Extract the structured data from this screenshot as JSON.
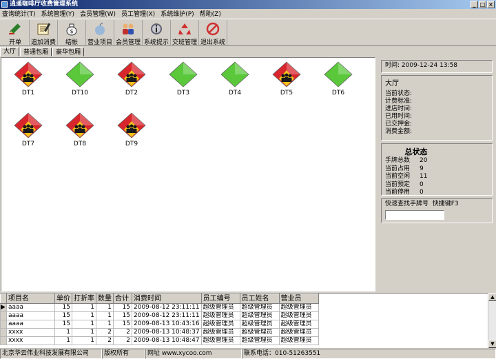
{
  "window": {
    "title": "逍遥咖啡厅收费管理系统"
  },
  "menu": [
    "查询统计(T)",
    "系统管理(Y)",
    "会员管理(W)",
    "员工管理(X)",
    "系统维护(P)",
    "帮助(Z)"
  ],
  "toolbar": [
    "开单",
    "追加消费",
    "结帐",
    "营业项目",
    "会员管理",
    "系统提示",
    "交班管理",
    "退出系统"
  ],
  "tabs": [
    "大厅",
    "普通包厢",
    "豪华包厢"
  ],
  "tables": [
    {
      "name": "DT1",
      "status": "occupied"
    },
    {
      "name": "DT10",
      "status": "free"
    },
    {
      "name": "DT2",
      "status": "occupied"
    },
    {
      "name": "DT3",
      "status": "free"
    },
    {
      "name": "DT4",
      "status": "free"
    },
    {
      "name": "DT5",
      "status": "occupied"
    },
    {
      "name": "DT6",
      "status": "free"
    },
    {
      "name": "DT7",
      "status": "occupied"
    },
    {
      "name": "DT8",
      "status": "occupied"
    },
    {
      "name": "DT9",
      "status": "occupied"
    }
  ],
  "colors": {
    "occupied": "#d8262c",
    "free": "#5ac83a",
    "person": "#1a1a1a",
    "person_bg": "#f2c21a"
  },
  "info": {
    "time_label": "时间:",
    "time_value": "2009-12-24 13:58",
    "area_title": "大厅",
    "fields": [
      "当前状态:",
      "计费标准:",
      "进店时间:",
      "已用时间:",
      "已交押金:",
      "消费金额:"
    ]
  },
  "summary": {
    "title": "总状态",
    "rows": [
      {
        "label": "手牌总数",
        "value": "20"
      },
      {
        "label": "当前占用",
        "value": "9"
      },
      {
        "label": "当前空闲",
        "value": "11"
      },
      {
        "label": "当前预定",
        "value": "0"
      },
      {
        "label": "当前停用",
        "value": "0"
      }
    ]
  },
  "search": {
    "label": "快速查找手牌号",
    "shortcut": "快捷键F3",
    "value": ""
  },
  "grid": {
    "columns": [
      "项目名",
      "单价",
      "打折率",
      "数量",
      "合计",
      "消费时间",
      "员工编号",
      "员工姓名",
      "营业员"
    ],
    "rows": [
      [
        "aaaa",
        "15",
        "1",
        "1",
        "15",
        "2009-08-12 23:11:11",
        "超级管理员",
        "超级管理员",
        "超级管理员"
      ],
      [
        "aaaa",
        "15",
        "1",
        "1",
        "15",
        "2009-08-12 23:11:11",
        "超级管理员",
        "超级管理员",
        "超级管理员"
      ],
      [
        "aaaa",
        "15",
        "1",
        "1",
        "15",
        "2009-08-13 10:43:16",
        "超级管理员",
        "超级管理员",
        "超级管理员"
      ],
      [
        "xxxx",
        "1",
        "1",
        "2",
        "2",
        "2009-08-13 10:48:37",
        "超级管理员",
        "超级管理员",
        "超级管理员"
      ],
      [
        "xxxx",
        "1",
        "1",
        "2",
        "2",
        "2009-08-13 10:48:47",
        "超级管理员",
        "超级管理员",
        "超级管理员"
      ]
    ]
  },
  "status": {
    "company": "北京华云伟业科技发展有限公司",
    "rights": "版权所有",
    "url_label": "网址",
    "url": "www.xycoo.com",
    "phone_label": "联系电话：",
    "phone": "010-51263551"
  }
}
